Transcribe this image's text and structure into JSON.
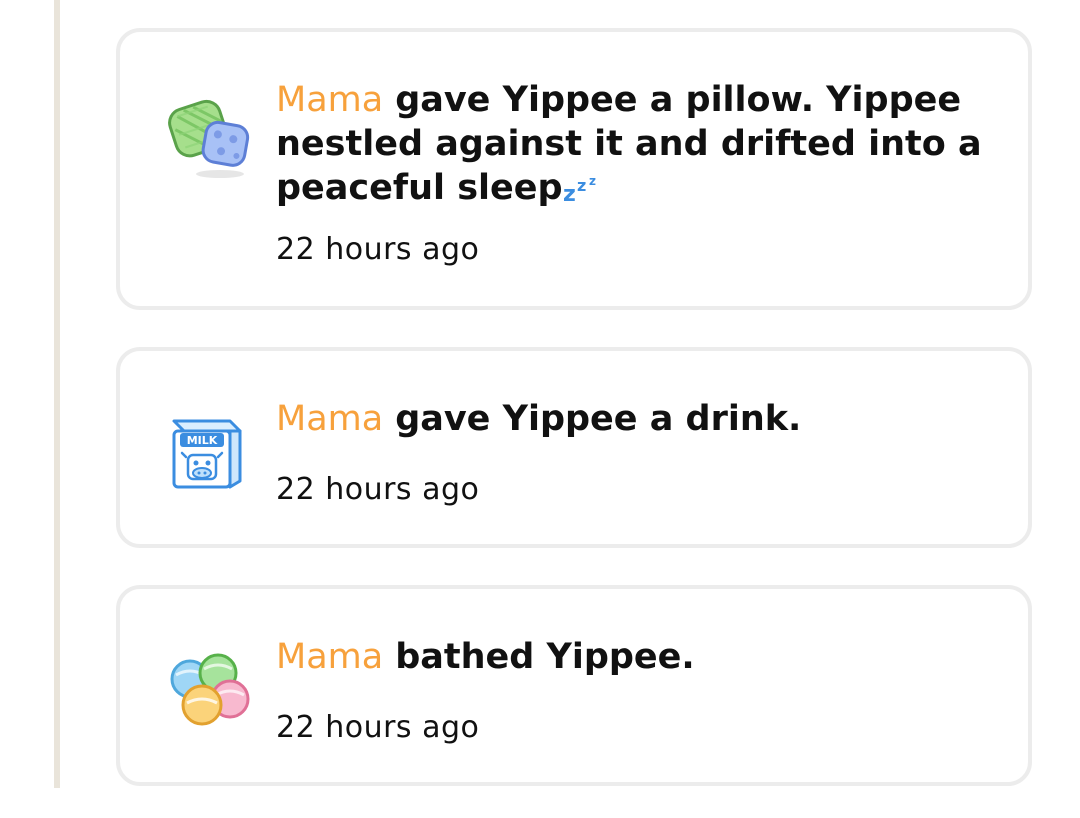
{
  "feed": {
    "items": [
      {
        "actor": "Mama",
        "message": "gave Yippee a pillow. Yippee nestled against it and drifted into a peaceful sleep",
        "icon": "pillow-icon",
        "trailing_icon": "zzz-icon",
        "time": "22 hours ago"
      },
      {
        "actor": "Mama",
        "message": "gave Yippee a drink.",
        "icon": "milk-carton-icon",
        "trailing_icon_text": "MILK",
        "time": "22 hours ago"
      },
      {
        "actor": "Mama",
        "message": "bathed Yippee.",
        "icon": "bath-bombs-icon",
        "time": "22 hours ago"
      }
    ]
  },
  "colors": {
    "actor": "#f7a13c",
    "text": "#111111",
    "card_border": "#ececec",
    "timeline": "#e9e4da"
  }
}
